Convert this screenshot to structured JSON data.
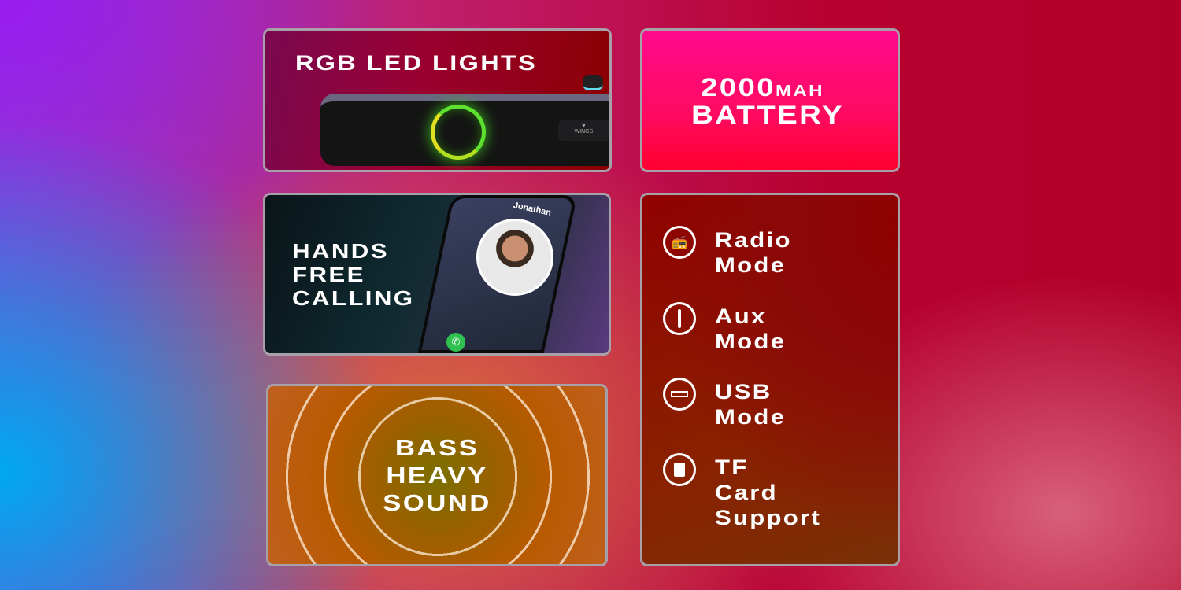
{
  "rgb_card": {
    "title": "RGB LED Lights",
    "brand": "WINGS"
  },
  "battery_card": {
    "capacity": "2000",
    "unit": "MAH",
    "label": "Battery"
  },
  "calling_card": {
    "lines": [
      "Hands",
      "Free",
      "Calling"
    ],
    "caller_name": "Jonathan"
  },
  "bass_card": {
    "lines": [
      "Bass",
      "Heavy",
      "Sound"
    ]
  },
  "modes_card": {
    "items": [
      {
        "icon": "radio-icon",
        "lines": [
          "Radio",
          "Mode"
        ]
      },
      {
        "icon": "aux-jack-icon",
        "lines": [
          "Aux",
          "Mode"
        ]
      },
      {
        "icon": "usb-icon",
        "lines": [
          "USB",
          "Mode"
        ]
      },
      {
        "icon": "sd-card-icon",
        "lines": [
          "TF",
          "Card",
          "Support"
        ]
      }
    ]
  }
}
